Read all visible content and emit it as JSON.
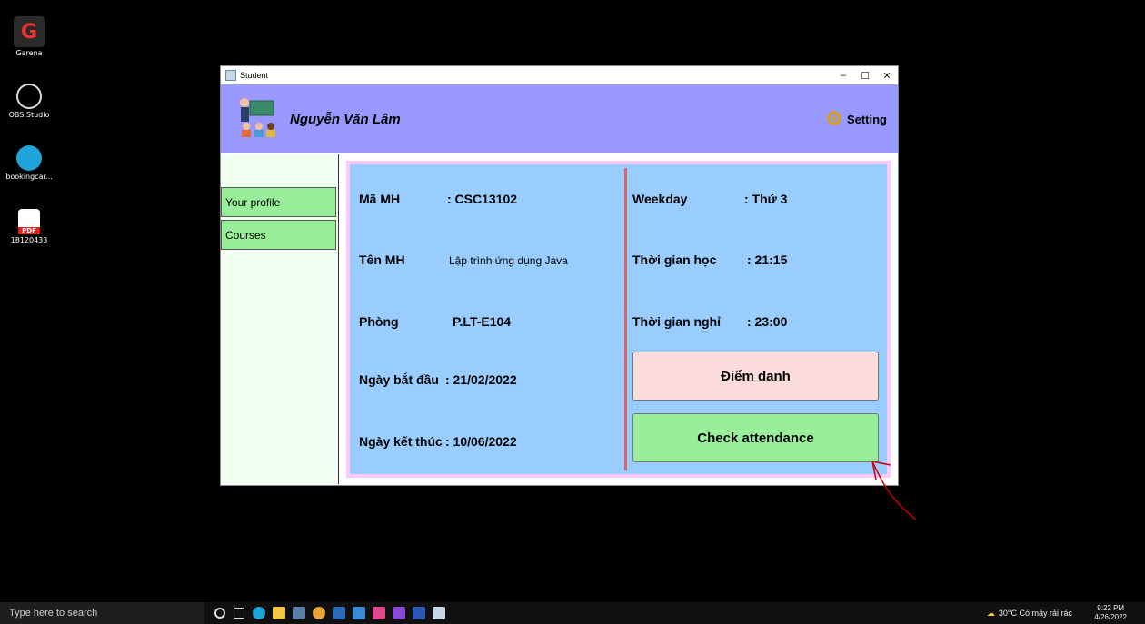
{
  "desktop": {
    "icons": [
      {
        "label": "Garena"
      },
      {
        "label": "OBS Studio"
      },
      {
        "label": "bookingcar..."
      },
      {
        "label": "18120433",
        "badge": "PDF"
      }
    ]
  },
  "window": {
    "title": "Student",
    "controls": {
      "minimize": "–",
      "maximize": "☐",
      "close": "✕"
    }
  },
  "header": {
    "username": "Nguyễn Văn Lâm",
    "setting_label": "Setting",
    "setting_icon": "gear-icon"
  },
  "sidebar": {
    "items": [
      {
        "label": "Your profile"
      },
      {
        "label": "Courses"
      }
    ]
  },
  "course": {
    "ma_mh": {
      "label": "Mã MH",
      "value": ": CSC13102"
    },
    "ten_mh": {
      "label": "Tên MH",
      "value": "Lập trình ứng dụng Java"
    },
    "phong": {
      "label": "Phòng",
      "value": "P.LT-E104"
    },
    "ngay_bat_dau": {
      "label": "Ngày bắt đầu",
      "value": ": 21/02/2022"
    },
    "ngay_ket_thuc": {
      "label": "Ngày kết thúc",
      "value": ": 10/06/2022"
    },
    "weekday": {
      "label": "Weekday",
      "value": ": Thứ 3"
    },
    "thoi_gian_hoc": {
      "label": "Thời gian học",
      "value": ": 21:15"
    },
    "thoi_gian_nghi": {
      "label": "Thời gian nghỉ",
      "value": ": 23:00"
    }
  },
  "actions": {
    "diem_danh": "Điểm danh",
    "check_attendance": "Check attendance"
  },
  "colors": {
    "header_bg": "#9999ff",
    "content_bg": "#99ccff",
    "diem_danh_bg": "#fcdcdc",
    "check_bg": "#99ee99",
    "divider": "#e06666"
  },
  "taskbar": {
    "search_placeholder": "Type here to search",
    "weather": "30°C  Có mây rải rác",
    "time": "9:22 PM",
    "date": "4/26/2022"
  }
}
